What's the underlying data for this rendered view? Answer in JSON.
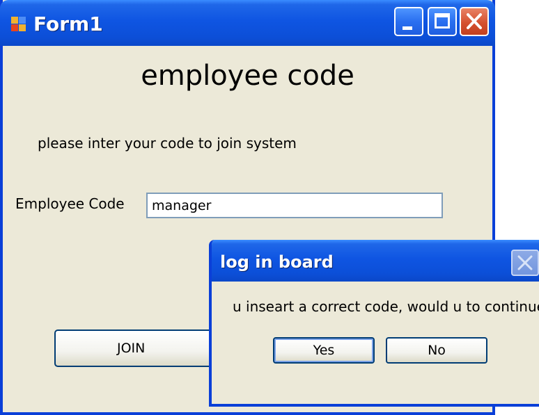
{
  "window": {
    "title": "Form1",
    "controls": {
      "minimize_icon": "minimize-icon",
      "maximize_icon": "maximize-icon",
      "close_icon": "close-icon"
    }
  },
  "form": {
    "heading": "employee code",
    "instruction": "please inter your code to join system",
    "code_label": "Employee Code",
    "code_value": "manager",
    "join_label": "JOIN"
  },
  "dialog": {
    "title": "log in board",
    "message": "u inseart a correct code, would u to continue",
    "yes_label": "Yes",
    "no_label": "No"
  },
  "colors": {
    "window_face": "#ECE9D8",
    "titlebar_blue": "#0F55E2",
    "close_red": "#D5512F",
    "input_border": "#7F9DB9"
  }
}
